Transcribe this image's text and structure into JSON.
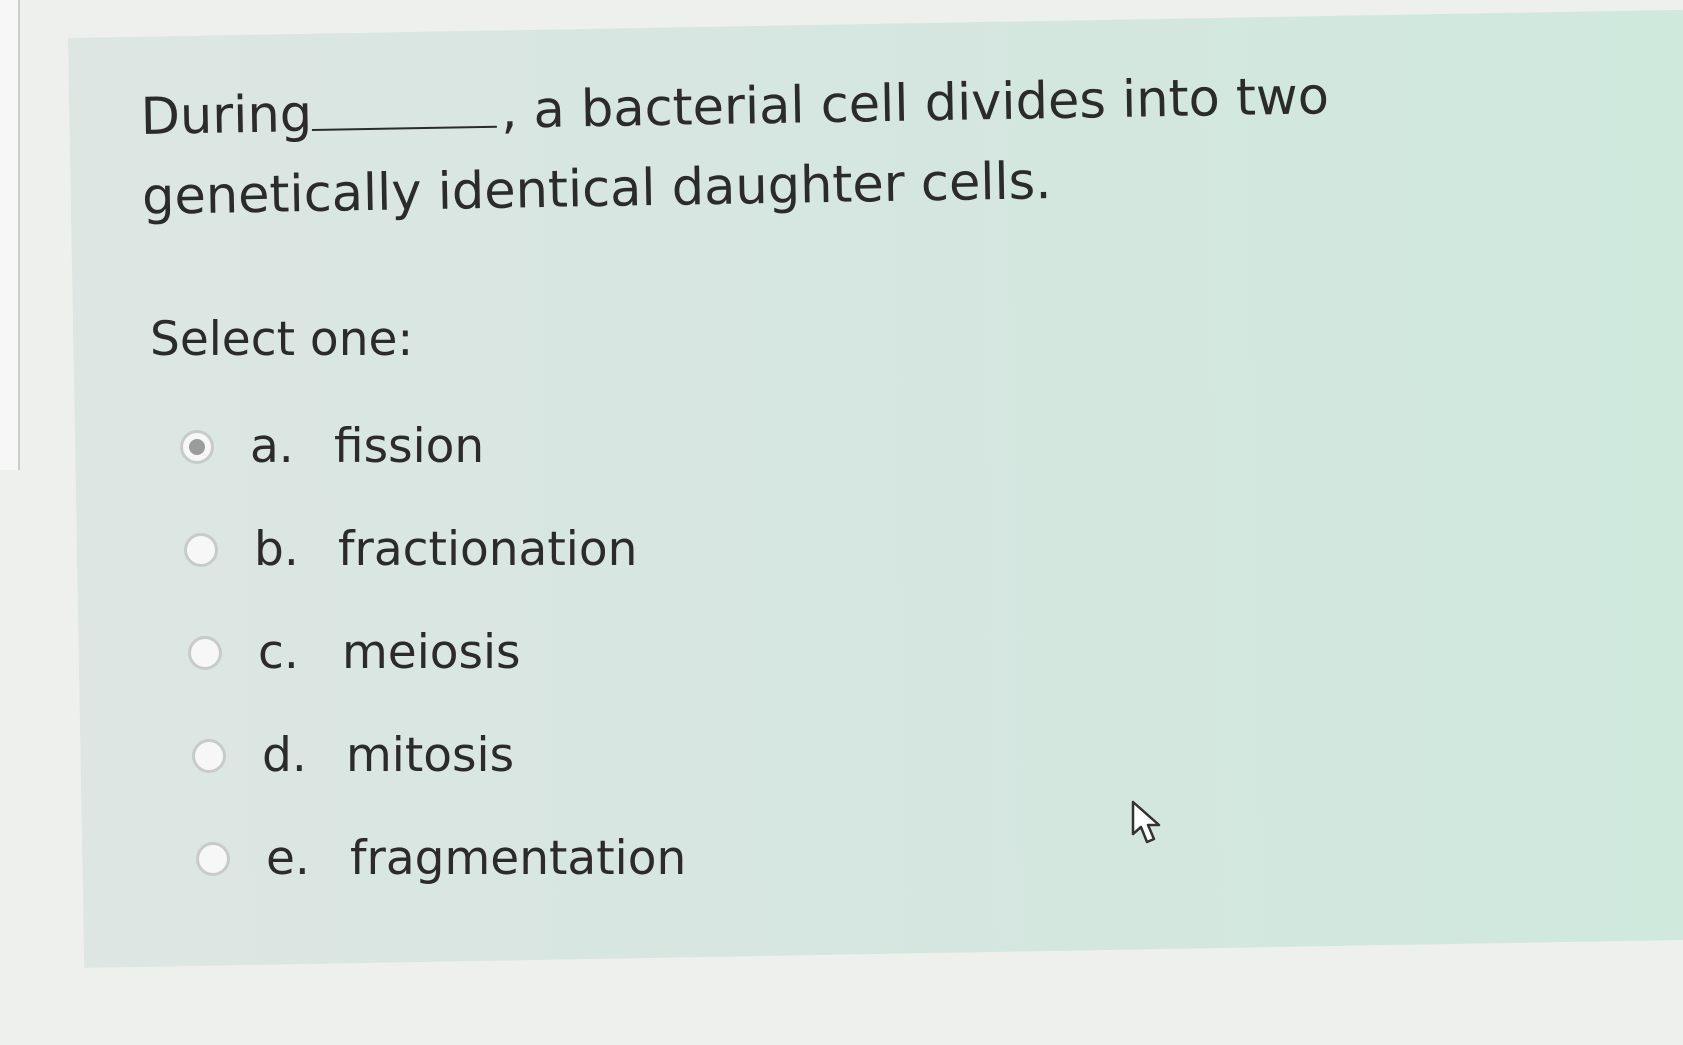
{
  "question": {
    "before_blank": "During",
    "after_blank": ", a bacterial cell divides into two genetically identical daughter cells."
  },
  "prompt": "Select one:",
  "options": [
    {
      "letter": "a.",
      "text": "fission",
      "selected": true
    },
    {
      "letter": "b.",
      "text": "fractionation",
      "selected": false
    },
    {
      "letter": "c.",
      "text": "meiosis",
      "selected": false
    },
    {
      "letter": "d.",
      "text": "mitosis",
      "selected": false
    },
    {
      "letter": "e.",
      "text": "fragmentation",
      "selected": false
    }
  ],
  "icons": {
    "cursor": "mouse-pointer-icon"
  },
  "colors": {
    "panel": "#d6e6e0",
    "text": "#2b2b2b",
    "radio_border": "#c7cbc9",
    "radio_checked": "#9a9d9c"
  }
}
